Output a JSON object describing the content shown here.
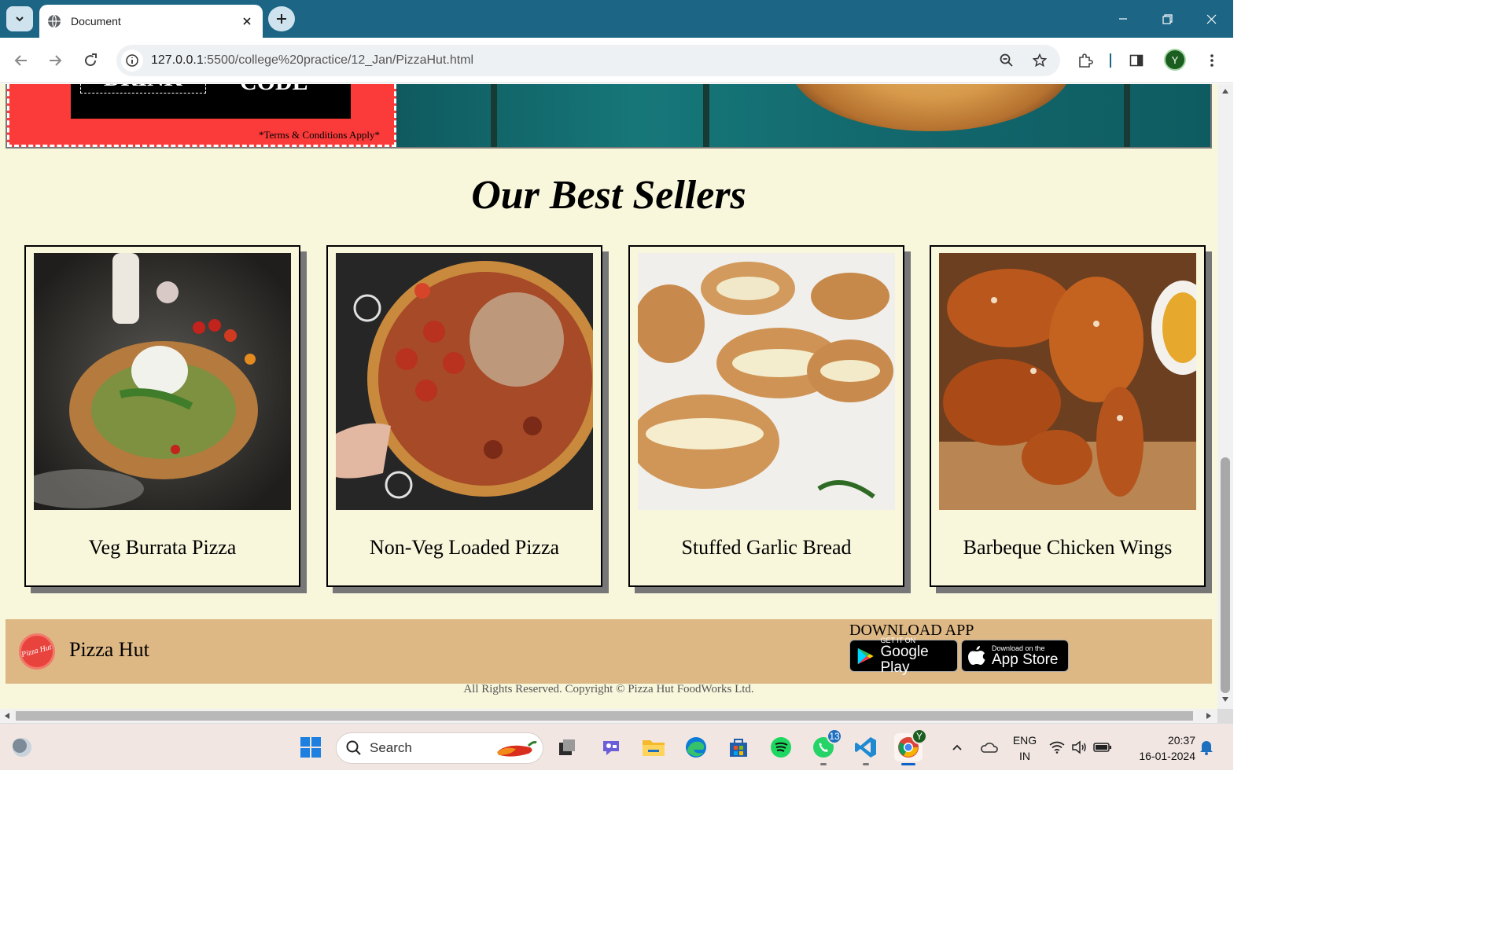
{
  "browser": {
    "tab_title": "Document",
    "url_host": "127.0.0.1",
    "url_path": ":5500/college%20practice/12_Jan/PizzaHut.html",
    "profile_initial": "Y"
  },
  "banner": {
    "coupon_left_text": "DRINK",
    "coupon_right_text": "CODE",
    "terms": "*Terms & Conditions Apply*"
  },
  "best_sellers": {
    "title": "Our Best Sellers",
    "items": [
      {
        "label": "Veg Burrata Pizza"
      },
      {
        "label": "Non-Veg Loaded Pizza"
      },
      {
        "label": "Stuffed Garlic Bread"
      },
      {
        "label": "Barbeque Chicken Wings"
      }
    ]
  },
  "footer": {
    "brand": "Pizza Hut",
    "logo_text": "Pizza Hut",
    "download_title": "DOWNLOAD APP",
    "google_play_small": "GET IT ON",
    "google_play_big": "Google Play",
    "app_store_small": "Download on the",
    "app_store_big": "App Store",
    "copyright": "All Rights Reserved. Copyright © Pizza Hut FoodWorks Ltd."
  },
  "taskbar": {
    "search_label": "Search",
    "whatsapp_badge": "13",
    "chrome_profile": "Y",
    "lang_line1": "ENG",
    "lang_line2": "IN",
    "time": "20:37",
    "date": "16-01-2024"
  },
  "colors": {
    "chrome_frame": "#1c6585",
    "page_bg": "#f8f7dc",
    "coupon_red": "#fb3a3a",
    "footer_tan": "#ddb884"
  }
}
